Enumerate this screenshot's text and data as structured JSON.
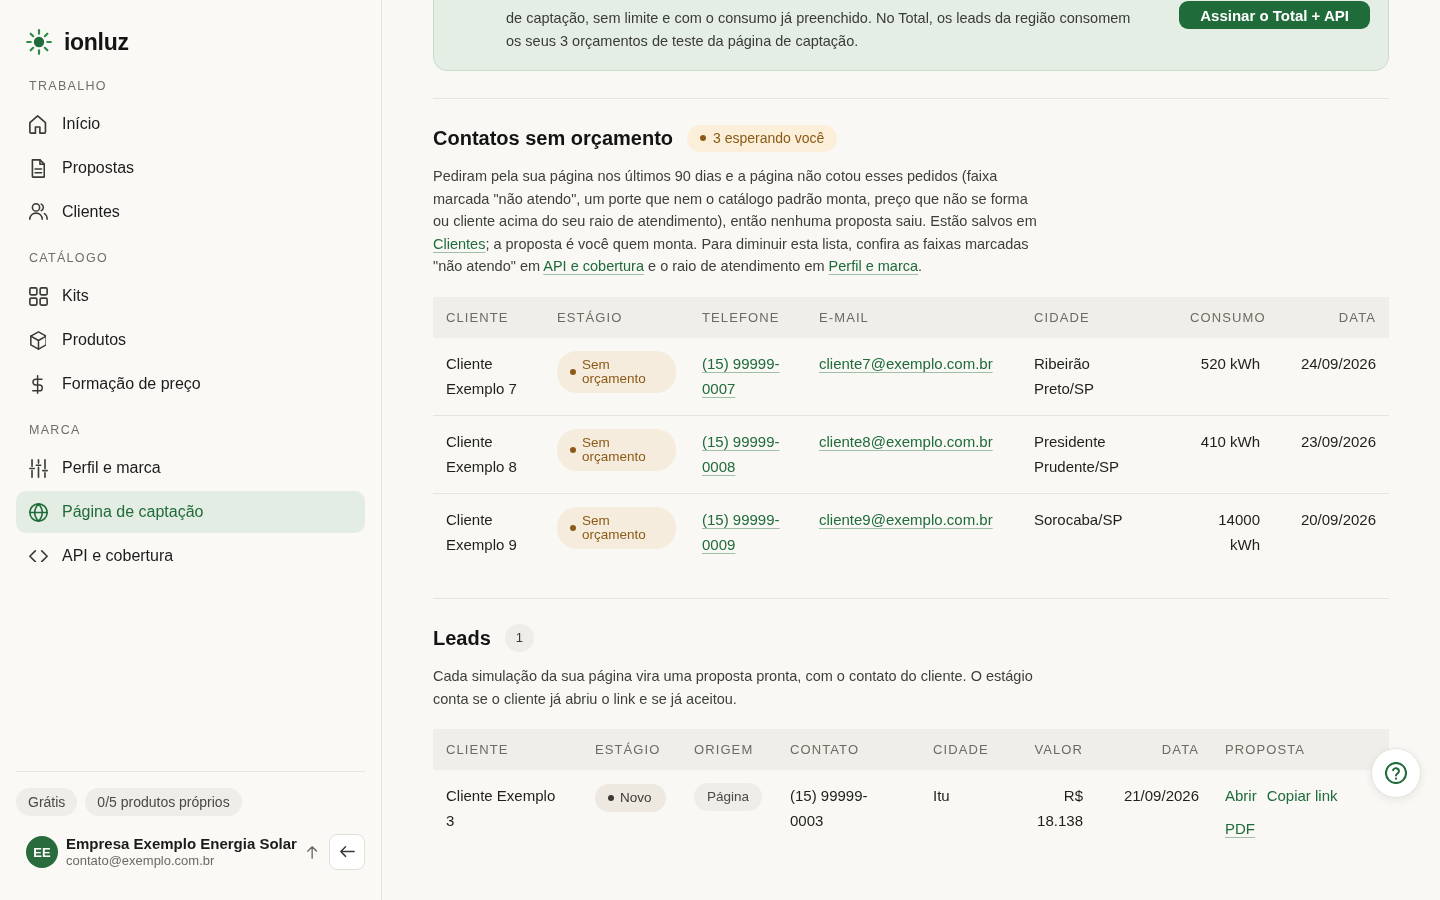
{
  "sidebar": {
    "brand": "ionluz",
    "sections": [
      {
        "heading": "TRABALHO",
        "items": [
          {
            "label": "Início",
            "selected": false
          },
          {
            "label": "Propostas",
            "selected": false
          },
          {
            "label": "Clientes",
            "selected": false
          }
        ]
      },
      {
        "heading": "CATÁLOGO",
        "items": [
          {
            "label": "Kits",
            "selected": false
          },
          {
            "label": "Produtos",
            "selected": false
          },
          {
            "label": "Formação de preço",
            "selected": false
          }
        ]
      },
      {
        "heading": "MARCA",
        "items": [
          {
            "label": "Perfil e marca",
            "selected": false
          },
          {
            "label": "Página de captação",
            "selected": true
          },
          {
            "label": "API e cobertura",
            "selected": false
          }
        ]
      }
    ],
    "chips": [
      "Grátis",
      "0/5 produtos próprios"
    ],
    "account": {
      "initials": "EE",
      "name": "Empresa Exemplo Energia Solar",
      "email": "contato@exemplo.com.br"
    }
  },
  "banner": {
    "text": "de captação, sem limite e com o consumo já preenchido. No Total, os leads da região consomem os seus 3 orçamentos de teste da página de captação.",
    "button": "Assinar o Total + API"
  },
  "contacts": {
    "title": "Contatos sem orçamento",
    "badge": "3 esperando você",
    "description": [
      {
        "kind": "text",
        "text": "Pediram pela sua página nos últimos 90 dias e a página não cotou esses pedidos (faixa marcada \"não atendo\", um porte que nem o catálogo padrão monta, preço que não se forma ou cliente acima do seu raio de atendimento), então nenhuma proposta saiu. Estão salvos em "
      },
      {
        "kind": "link",
        "text": "Clientes"
      },
      {
        "kind": "text",
        "text": "; a proposta é você quem monta. Para diminuir esta lista, confira as faixas marcadas \"não atendo\" em "
      },
      {
        "kind": "link",
        "text": "API e cobertura"
      },
      {
        "kind": "text",
        "text": " e o raio de atendimento em "
      },
      {
        "kind": "link",
        "text": "Perfil e marca"
      },
      {
        "kind": "text",
        "text": "."
      }
    ],
    "table": {
      "columns": [
        "CLIENTE",
        "ESTÁGIO",
        "TELEFONE",
        "E-MAIL",
        "CIDADE",
        "CONSUMO",
        "DATA"
      ],
      "rows": [
        {
          "client": "Cliente Exemplo 7",
          "stage": {
            "label": "Sem orçamento",
            "color": "#8c5a16"
          },
          "phone": "(15) 99999-0007",
          "email": "cliente7@exemplo.com.br",
          "city": "Ribeirão Preto/SP",
          "consumption": "520 kWh",
          "date": "24/09/2026"
        },
        {
          "client": "Cliente Exemplo 8",
          "stage": {
            "label": "Sem orçamento",
            "color": "#8c5a16"
          },
          "phone": "(15) 99999-0008",
          "email": "cliente8@exemplo.com.br",
          "city": "Presidente Prudente/SP",
          "consumption": "410 kWh",
          "date": "23/09/2026"
        },
        {
          "client": "Cliente Exemplo 9",
          "stage": {
            "label": "Sem orçamento",
            "color": "#8c5a16"
          },
          "phone": "(15) 99999-0009",
          "email": "cliente9@exemplo.com.br",
          "city": "Sorocaba/SP",
          "consumption": "14000 kWh",
          "date": "20/09/2026"
        }
      ]
    }
  },
  "leads": {
    "title": "Leads",
    "count": "1",
    "description": [
      {
        "kind": "text",
        "text": "Cada simulação da sua página vira uma proposta pronta, com o contato do cliente. O estágio conta se o cliente já abriu o link e se já aceitou."
      }
    ],
    "table": {
      "columns": [
        "CLIENTE",
        "ESTÁGIO",
        "ORIGEM",
        "CONTATO",
        "CIDADE",
        "VALOR",
        "DATA",
        "PROPOSTA"
      ],
      "rows": [
        {
          "client": "Cliente Exemplo 3",
          "stage": {
            "label": "Novo",
            "color": "#3a3a36"
          },
          "origin": "Página",
          "contact": "(15) 99999-0003",
          "city": "Itu",
          "value": "R$ 18.138",
          "date": "21/09/2026",
          "proposal": [
            {
              "label": "Abrir",
              "kind": "action"
            },
            {
              "label": "Copiar link",
              "kind": "action"
            },
            {
              "label": "PDF",
              "kind": "file"
            }
          ]
        }
      ]
    }
  }
}
